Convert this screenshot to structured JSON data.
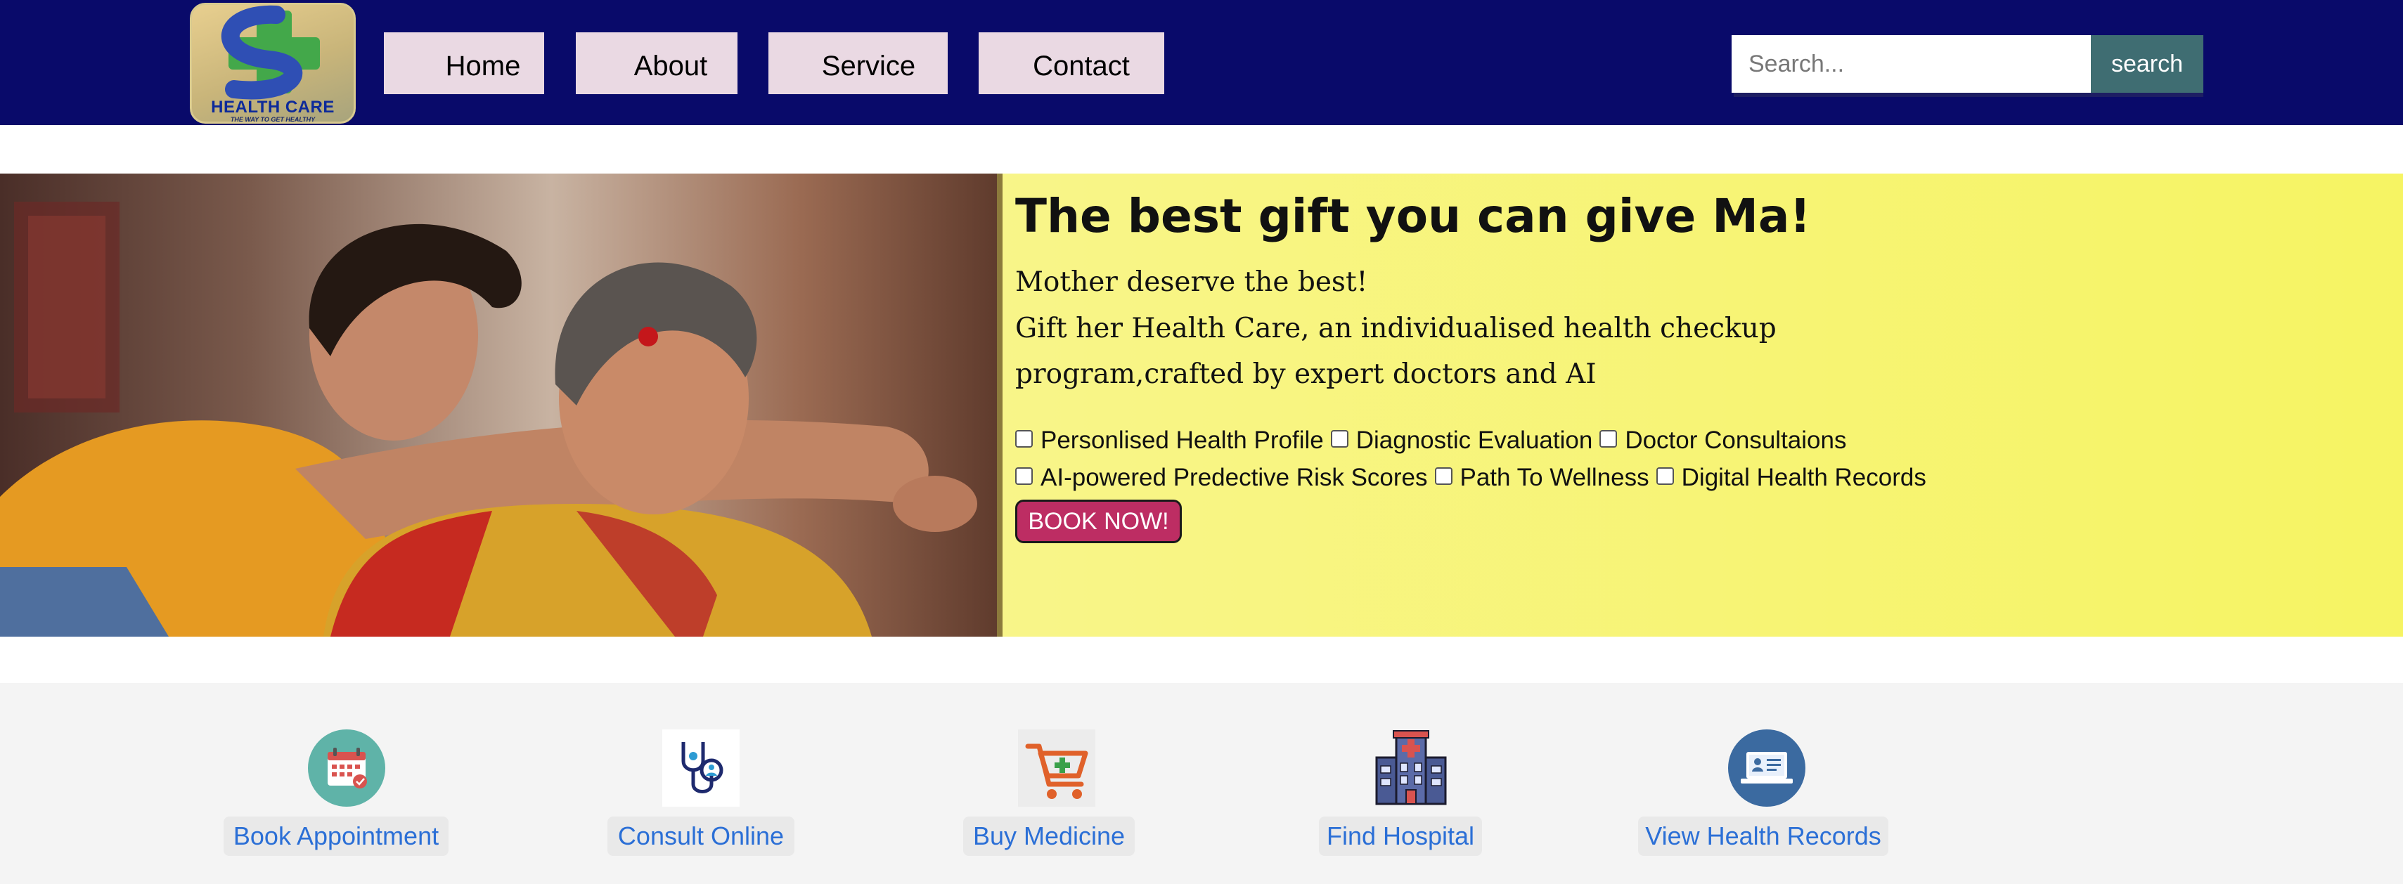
{
  "brand": {
    "logo_title": "HEALTH CARE",
    "logo_tagline": "THE WAY TO GET HEALTHY"
  },
  "nav": {
    "items": [
      {
        "label": "Home"
      },
      {
        "label": "About"
      },
      {
        "label": "Service"
      },
      {
        "label": "Contact"
      }
    ]
  },
  "search": {
    "placeholder": "Search...",
    "value": "",
    "button_label": "search"
  },
  "hero": {
    "title": "The best gift you can give Ma!",
    "line1": "Mother deserve the best!",
    "line2": "Gift her Health Care, an individualised health checkup",
    "line3": "program,crafted by expert doctors and AI",
    "options_row1": [
      {
        "label": "Personlised Health Profile",
        "checked": false
      },
      {
        "label": "Diagnostic Evaluation",
        "checked": false
      },
      {
        "label": "Doctor Consultaions",
        "checked": false
      }
    ],
    "options_row2": [
      {
        "label": "AI-powered Predective Risk Scores",
        "checked": false
      },
      {
        "label": "Path To Wellness",
        "checked": false
      },
      {
        "label": "Digital Health Records",
        "checked": false
      }
    ],
    "cta_label": "BOOK NOW!"
  },
  "services": [
    {
      "label": "Book Appointment",
      "icon": "calendar-icon"
    },
    {
      "label": "Consult Online",
      "icon": "stethoscope-icon"
    },
    {
      "label": "Buy Medicine",
      "icon": "cart-icon"
    },
    {
      "label": "Find Hospital",
      "icon": "hospital-icon"
    },
    {
      "label": "View Health Records",
      "icon": "health-record-icon"
    }
  ],
  "colors": {
    "navbar": "#090a6a",
    "nav_button": "#ead9e3",
    "search_button": "#3f6d72",
    "hero_bg": "#f6f463",
    "cta": "#bd2d63",
    "service_link": "#2b6fd6",
    "services_bg": "#f4f4f4"
  }
}
